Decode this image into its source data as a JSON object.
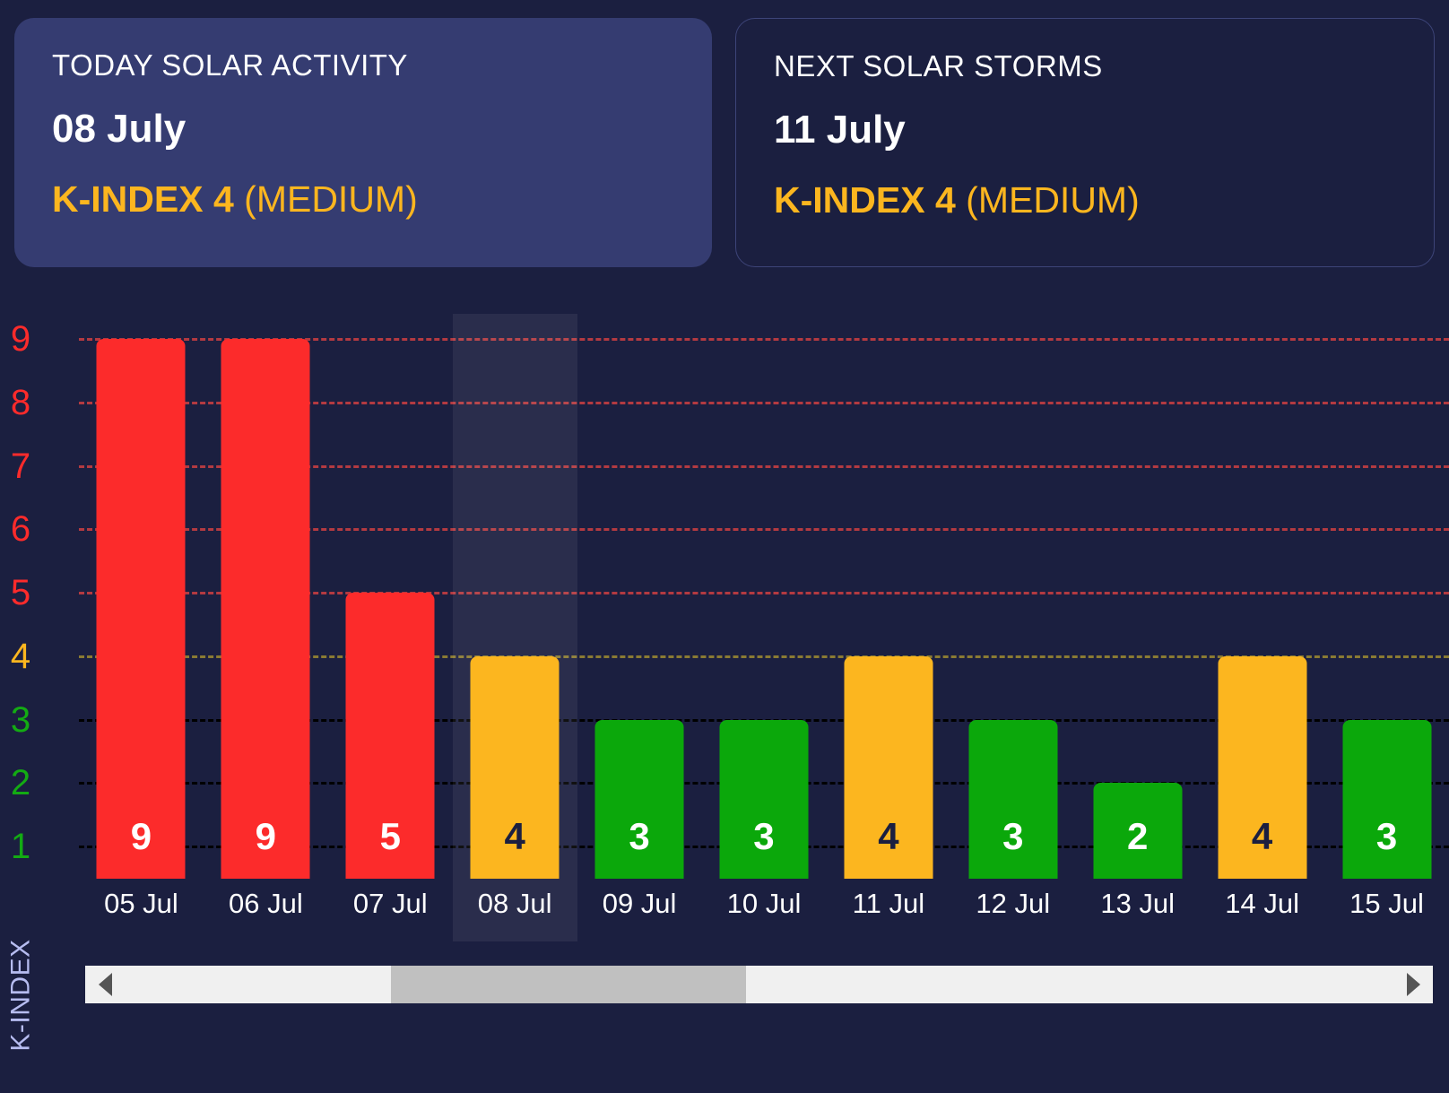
{
  "cards": [
    {
      "id": "today-solar-activity",
      "title": "TODAY SOLAR ACTIVITY",
      "date": "08 July",
      "kindex_label": "K-INDEX 4",
      "kindex_level": "(MEDIUM)",
      "highlighted": true
    },
    {
      "id": "next-solar-storms",
      "title": "NEXT SOLAR STORMS",
      "date": "11 July",
      "kindex_label": "K-INDEX 4",
      "kindex_level": "(MEDIUM)",
      "highlighted": false
    }
  ],
  "axis_title": "K-INDEX",
  "colors": {
    "background": "#1b1f40",
    "card_highlight": "#353c71",
    "accent_amber": "#fcb61f",
    "bar_red": "#fc2b2b",
    "bar_amber": "#fcb61f",
    "bar_green": "#0ba80b",
    "grid_red": "#b33a41",
    "grid_amber": "#8a7b33",
    "grid_blue": "#3c447a",
    "axis_title": "#b6bcf0"
  },
  "scrollbar": {
    "left_arrow": "triangle-left",
    "right_arrow": "triangle-right",
    "thumb_start_pct": 21,
    "thumb_width_pct": 28
  },
  "chart_data": {
    "type": "bar",
    "title": "",
    "xlabel": "",
    "ylabel": "K-INDEX",
    "ylim": [
      1,
      9
    ],
    "grid": true,
    "categories": [
      "05 Jul",
      "06 Jul",
      "07 Jul",
      "08 Jul",
      "09 Jul",
      "10 Jul",
      "11 Jul",
      "12 Jul",
      "13 Jul",
      "14 Jul",
      "15 Jul"
    ],
    "values": [
      9,
      9,
      5,
      4,
      3,
      3,
      4,
      3,
      2,
      4,
      3
    ],
    "bar_colors": [
      "red",
      "red",
      "red",
      "amber",
      "green",
      "green",
      "amber",
      "green",
      "green",
      "amber",
      "green"
    ],
    "highlighted_category": "08 Jul",
    "y_ticks": [
      9,
      8,
      7,
      6,
      5,
      4,
      3,
      2,
      1
    ],
    "y_tick_colors": [
      "red",
      "red",
      "red",
      "red",
      "red",
      "amber",
      "green",
      "green",
      "green"
    ],
    "legend": []
  }
}
